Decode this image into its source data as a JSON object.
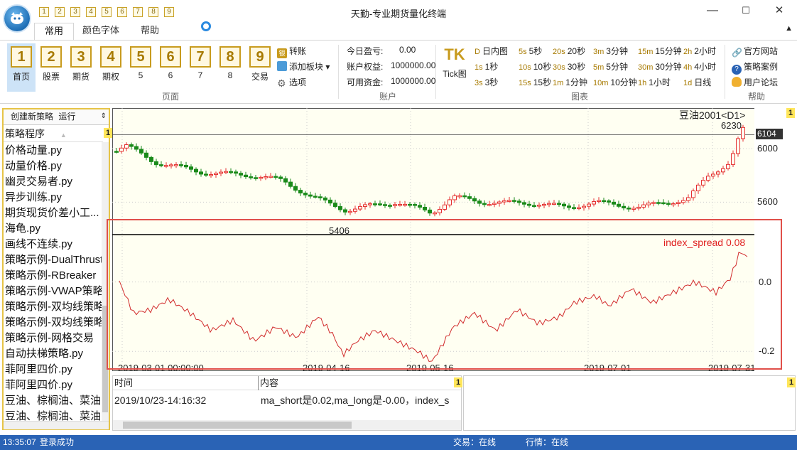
{
  "app": {
    "title": "天勤-专业期货量化终端",
    "quick_nums": [
      "1",
      "2",
      "3",
      "4",
      "5",
      "6",
      "7",
      "8",
      "9"
    ]
  },
  "window_controls": {
    "minimize": "—",
    "maximize": "☐",
    "close": "✕"
  },
  "tabs": [
    "常用",
    "颜色字体",
    "帮助"
  ],
  "ribbon_collapse": "▲",
  "page_buttons": [
    {
      "num": "1",
      "label": "首页"
    },
    {
      "num": "2",
      "label": "股票"
    },
    {
      "num": "3",
      "label": "期货"
    },
    {
      "num": "4",
      "label": "期权"
    },
    {
      "num": "5",
      "label": "5"
    },
    {
      "num": "6",
      "label": "6"
    },
    {
      "num": "7",
      "label": "7"
    },
    {
      "num": "8",
      "label": "8"
    },
    {
      "num": "9",
      "label": "交易"
    }
  ],
  "page_group_label": "页面",
  "trade_tools": {
    "transfer": "转账",
    "add_board": "添加板块",
    "options": "选项"
  },
  "account": {
    "label": "账户",
    "pnl_label": "今日盈亏:",
    "pnl_value": "0.00",
    "equity_label": "账户权益:",
    "equity_value": "1000000.00",
    "available_label": "可用资金:",
    "available_value": "1000000.00"
  },
  "chart_group": {
    "label": "图表",
    "tick_icon": "TK",
    "tick_label": "Tick图",
    "timeframes": [
      {
        "key": "D",
        "label": "日内图"
      },
      {
        "key": "5s",
        "label": "5秒"
      },
      {
        "key": "20s",
        "label": "20秒"
      },
      {
        "key": "3m",
        "label": "3分钟"
      },
      {
        "key": "15m",
        "label": "15分钟"
      },
      {
        "key": "2h",
        "label": "2小时"
      },
      {
        "key": "1s",
        "label": "1秒"
      },
      {
        "key": "10s",
        "label": "10秒"
      },
      {
        "key": "30s",
        "label": "30秒"
      },
      {
        "key": "5m",
        "label": "5分钟"
      },
      {
        "key": "30m",
        "label": "30分钟"
      },
      {
        "key": "4h",
        "label": "4小时"
      },
      {
        "key": "3s",
        "label": "3秒"
      },
      {
        "key": "15s",
        "label": "15秒"
      },
      {
        "key": "1m",
        "label": "1分钟"
      },
      {
        "key": "10m",
        "label": "10分钟"
      },
      {
        "key": "1h",
        "label": "1小时"
      },
      {
        "key": "1d",
        "label": "日线"
      }
    ]
  },
  "help_group": {
    "label": "帮助",
    "official_site": "官方网站",
    "cases": "策略案例",
    "forum": "用户论坛"
  },
  "strategy_panel": {
    "create": "创建新策略",
    "run": "运行",
    "list_header": "策略程序",
    "sort_icon": "▲",
    "marker": "1",
    "items": [
      "价格动量.py",
      "动量价格.py",
      "幽灵交易者.py",
      "异步训练.py",
      "期货现货价差小工...",
      "海龟.py",
      "画线不连续.py",
      "策略示例-DualThrust",
      "策略示例-RBreaker",
      "策略示例-VWAP策略",
      "策略示例-双均线策略",
      "策略示例-双均线策略",
      "策略示例-网格交易",
      "自动扶梯策略.py",
      "菲阿里四价.py",
      "菲阿里四价.py",
      "豆油、棕榈油、菜油",
      "豆油、棕榈油、菜油"
    ]
  },
  "chart": {
    "marker": "1",
    "symbol_label": "豆油2001<D1>",
    "current_price": "6104",
    "high_label": "6230",
    "low_label": "5406",
    "indicator_label": "index_spread 0.08",
    "x_ticks": [
      "2019-03-01 00:00:00",
      "2019-04-16",
      "2019-05-16",
      "2019-07-01",
      "2019-07-31"
    ],
    "price_ticks": [
      "6000",
      "5600"
    ],
    "indicator_ticks": [
      "0.0",
      "-0.2"
    ]
  },
  "chart_data": {
    "type": "line",
    "title": "豆油2001<D1>",
    "x": [
      "2019-03-01",
      "2019-04-16",
      "2019-05-16",
      "2019-07-01",
      "2019-07-31"
    ],
    "series": [
      {
        "name": "豆油2001",
        "values": [
          5980,
          5406,
          5480,
          5560,
          6230
        ]
      },
      {
        "name": "index_spread",
        "values": [
          -0.02,
          -0.22,
          -0.19,
          -0.05,
          0.08
        ]
      }
    ],
    "ylim_price": [
      5400,
      6250
    ],
    "ylim_indicator": [
      -0.22,
      0.12
    ]
  },
  "log_panel": {
    "marker": "1",
    "col_time": "时间",
    "col_content": "内容",
    "rows": [
      {
        "time": "2019/10/23-14:16:32",
        "content": "ma_short是0.02,ma_long是-0.00，index_s"
      }
    ]
  },
  "right_panel": {
    "marker": "1"
  },
  "status": {
    "time": "13:35:07",
    "message": "登录成功",
    "trade": "交易：在线",
    "quote": "行情：在线"
  },
  "colors": {
    "accent": "#2a63b5",
    "gold": "#c89b1e",
    "up": "#e53030",
    "down": "#1a8a1a",
    "highlight": "#e0504a"
  }
}
